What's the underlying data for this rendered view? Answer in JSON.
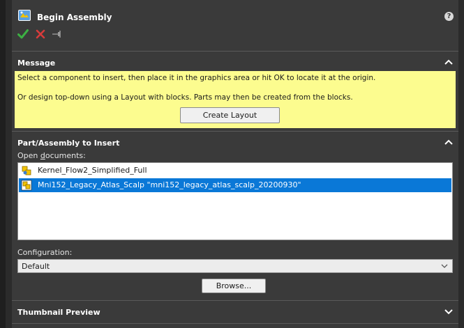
{
  "header": {
    "title": "Begin Assembly",
    "help_glyph": "?",
    "icons": [
      "assembly-icon",
      "help-icon",
      "ok-check-icon",
      "cancel-x-icon",
      "pushpin-icon"
    ]
  },
  "message_section": {
    "title": "Message",
    "line1": "Select a component to insert, then place it in the graphics area or hit OK to locate it at the origin.",
    "line2": "Or design top-down using a Layout with blocks. Parts may then be created from the blocks.",
    "create_layout_label": "Create Layout"
  },
  "part_section": {
    "title": "Part/Assembly to Insert",
    "open_docs_label_pre": "Open ",
    "open_docs_label_accel": "d",
    "open_docs_label_post": "ocuments:",
    "documents": [
      {
        "name": "Kernel_Flow2_Simplified_Full",
        "selected": false
      },
      {
        "name": "Mni152_Legacy_Atlas_Scalp \"mni152_legacy_atlas_scalp_20200930\"",
        "selected": true
      }
    ],
    "configuration_label": "Configuration:",
    "configuration_value": "Default",
    "browse_label": "Browse..."
  },
  "thumbnail_section": {
    "title": "Thumbnail Preview"
  },
  "colors": {
    "panel_bg": "#3a3a3a",
    "message_bg": "#fcfc8f",
    "selection": "#0a78d7",
    "ok_green": "#3cb043",
    "cancel_red": "#d83b3b"
  }
}
